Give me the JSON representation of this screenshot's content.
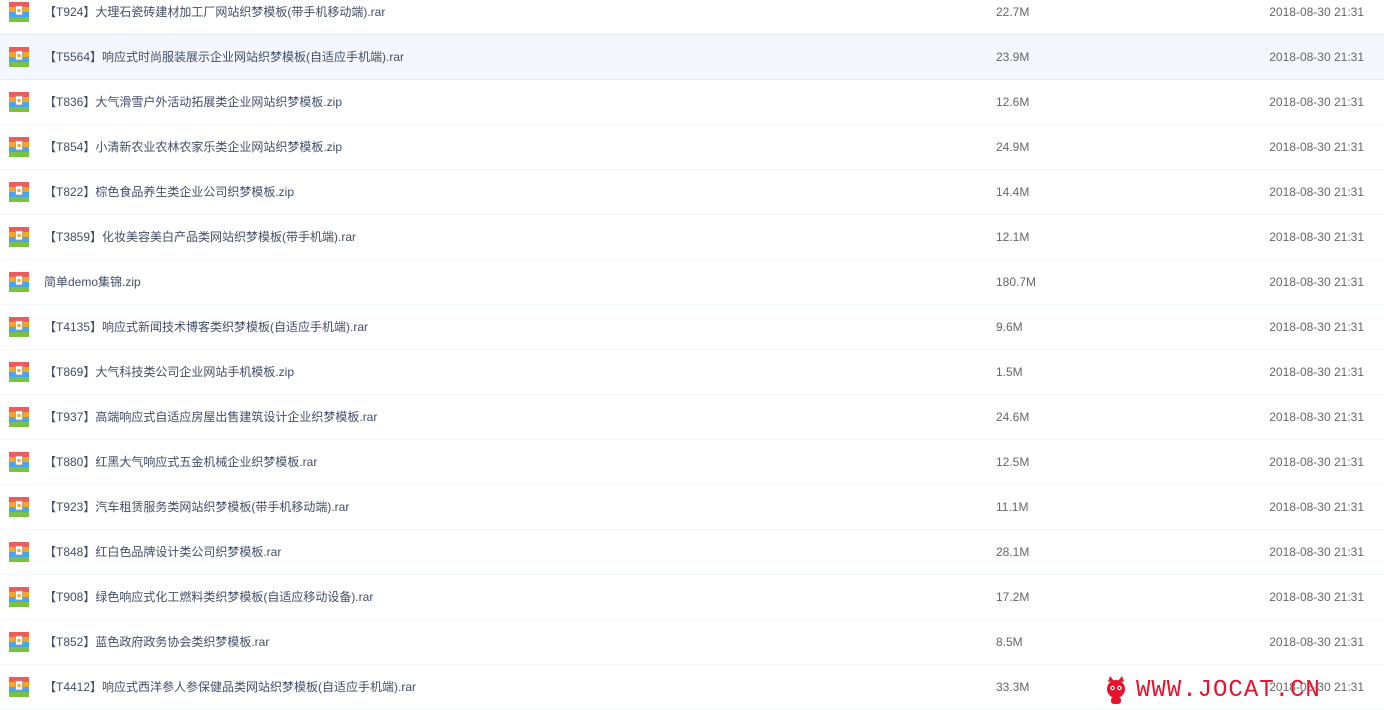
{
  "files": [
    {
      "name": "【T924】大理石瓷砖建材加工厂网站织梦模板(带手机移动端).rar",
      "size": "22.7M",
      "date": "2018-08-30 21:31"
    },
    {
      "name": "【T5564】响应式时尚服装展示企业网站织梦模板(自适应手机端).rar",
      "size": "23.9M",
      "date": "2018-08-30 21:31",
      "hovered": true
    },
    {
      "name": "【T836】大气滑雪户外活动拓展类企业网站织梦模板.zip",
      "size": "12.6M",
      "date": "2018-08-30 21:31"
    },
    {
      "name": "【T854】小清新农业农林农家乐类企业网站织梦模板.zip",
      "size": "24.9M",
      "date": "2018-08-30 21:31"
    },
    {
      "name": "【T822】棕色食品养生类企业公司织梦模板.zip",
      "size": "14.4M",
      "date": "2018-08-30 21:31"
    },
    {
      "name": "【T3859】化妆美容美白产品类网站织梦模板(带手机端).rar",
      "size": "12.1M",
      "date": "2018-08-30 21:31"
    },
    {
      "name": "简单demo集锦.zip",
      "size": "180.7M",
      "date": "2018-08-30 21:31"
    },
    {
      "name": "【T4135】响应式新闻技术博客类织梦模板(自适应手机端).rar",
      "size": "9.6M",
      "date": "2018-08-30 21:31"
    },
    {
      "name": "【T869】大气科技类公司企业网站手机模板.zip",
      "size": "1.5M",
      "date": "2018-08-30 21:31"
    },
    {
      "name": "【T937】高端响应式自适应房屋出售建筑设计企业织梦模板.rar",
      "size": "24.6M",
      "date": "2018-08-30 21:31"
    },
    {
      "name": "【T880】红黑大气响应式五金机械企业织梦模板.rar",
      "size": "12.5M",
      "date": "2018-08-30 21:31"
    },
    {
      "name": "【T923】汽车租赁服务类网站织梦模板(带手机移动端).rar",
      "size": "11.1M",
      "date": "2018-08-30 21:31"
    },
    {
      "name": "【T848】红白色品牌设计类公司织梦模板.rar",
      "size": "28.1M",
      "date": "2018-08-30 21:31"
    },
    {
      "name": "【T908】绿色响应式化工燃料类织梦模板(自适应移动设备).rar",
      "size": "17.2M",
      "date": "2018-08-30 21:31"
    },
    {
      "name": "【T852】蓝色政府政务协会类织梦模板.rar",
      "size": "8.5M",
      "date": "2018-08-30 21:31"
    },
    {
      "name": "【T4412】响应式西洋参人参保健品类网站织梦模板(自适应手机端).rar",
      "size": "33.3M",
      "date": "2018-08-30 21:31"
    }
  ],
  "icon": "archive-file-icon",
  "watermark": {
    "text": "WWW.JOCAT.CN",
    "color": "#e8132b"
  },
  "colors": {
    "row_hover": "#f4f8fe",
    "text": "#424e67",
    "row_divider": "#f2f6fd"
  }
}
